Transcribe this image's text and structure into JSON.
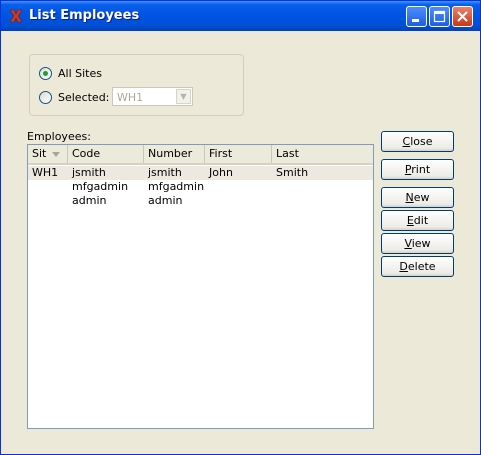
{
  "window": {
    "title": "List Employees"
  },
  "sites": {
    "all_label": "All Sites",
    "all_selected": true,
    "selected_label": "Selected:",
    "selected_value": "WH1"
  },
  "employees": {
    "label": "Employees:",
    "columns": [
      "Sit",
      "Code",
      "Number",
      "First",
      "Last"
    ],
    "rows": [
      {
        "site": "WH1",
        "code": "jsmith",
        "number": "jsmith",
        "first": "John",
        "last": "Smith"
      },
      {
        "site": "",
        "code": "mfgadmin",
        "number": "mfgadmin",
        "first": "",
        "last": ""
      },
      {
        "site": "",
        "code": "admin",
        "number": "admin",
        "first": "",
        "last": ""
      }
    ]
  },
  "buttons": {
    "close": {
      "mn": "C",
      "rest": "lose"
    },
    "print": {
      "mn": "P",
      "rest": "rint"
    },
    "new": {
      "mn": "N",
      "rest": "ew"
    },
    "edit": {
      "mn": "E",
      "rest": "dit"
    },
    "view": {
      "mn": "V",
      "rest": "iew"
    },
    "delete": {
      "mn": "D",
      "rest": "elete"
    }
  },
  "colors": {
    "titlebar": "#0054e3",
    "face": "#ece9d8",
    "radio_dot": "#21a121"
  }
}
